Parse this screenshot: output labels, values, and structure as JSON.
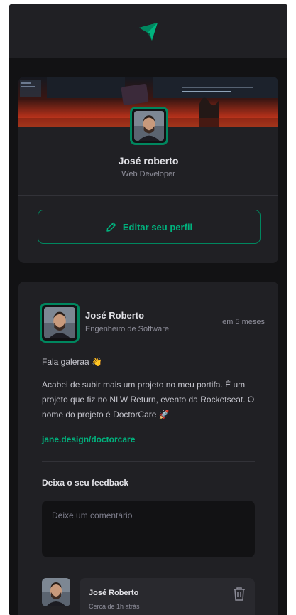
{
  "colors": {
    "accent": "#00b37e",
    "accent_border": "#00875f",
    "background": "#121214",
    "card": "#202024",
    "text": "#e1e1e6",
    "muted": "#8d8d99"
  },
  "header": {
    "logo_icon": "paper-plane-logo-icon"
  },
  "profile": {
    "name": "José roberto",
    "role": "Web Developer",
    "edit_label": "Editar seu perfil",
    "edit_icon": "pencil-icon"
  },
  "post": {
    "author_name": "José Roberto",
    "author_role": "Engenheiro de Software",
    "time": "em 5 meses",
    "paragraphs": [
      "Fala galeraa 👋",
      "Acabei de subir mais um projeto no meu portifa. É um projeto que fiz no NLW Return, evento da Rocketseat. O nome do projeto é DoctorCare 🚀"
    ],
    "link": "jane.design/doctorcare",
    "feedback_title": "Deixa o seu feedback",
    "comment_placeholder": "Deixe um comentário"
  },
  "comments": [
    {
      "author": "José Roberto",
      "time": "Cerca de 1h atrás",
      "delete_icon": "trash-icon"
    }
  ]
}
